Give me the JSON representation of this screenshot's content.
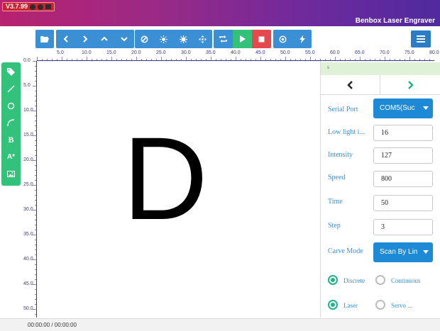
{
  "window": {
    "version": "V3.7.99",
    "title": "Benbox Laser Engraver"
  },
  "toolbar": {
    "groups": [
      [
        "open-folder"
      ],
      [
        "arrow-left",
        "arrow-right",
        "arrow-up",
        "arrow-down"
      ],
      [
        "circle-slash",
        "dot-small",
        "dot-large",
        "crosshair"
      ],
      [
        "repeat",
        "play",
        "stop"
      ],
      [
        "target",
        "bolt"
      ]
    ]
  },
  "rulers": {
    "top": [
      "5.0",
      "10.0",
      "15.0",
      "20.0",
      "25.0",
      "30.0",
      "35.0",
      "40.0",
      "45.0",
      "50.0",
      "55.0",
      "60.0",
      "65.0",
      "70.0",
      "75.0",
      "80.0"
    ],
    "left": [
      "0.0",
      "5.0",
      "10.0",
      "15.0",
      "20.0",
      "25.0",
      "30.0",
      "35.0",
      "40.0",
      "45.0",
      "50.0"
    ]
  },
  "tools": [
    "tag",
    "line",
    "circle",
    "arc",
    "B",
    "A*",
    "image"
  ],
  "canvas": {
    "text": "D"
  },
  "panel": {
    "header": "s",
    "properties": [
      {
        "label": "Serial Port",
        "type": "select",
        "value": "COM5(Suc"
      },
      {
        "label": "Low light i...",
        "type": "input",
        "value": "16"
      },
      {
        "label": "Intensity",
        "type": "input",
        "value": "127"
      },
      {
        "label": "Speed",
        "type": "input",
        "value": "800"
      },
      {
        "label": "Time",
        "type": "input",
        "value": "50"
      },
      {
        "label": "Step",
        "type": "input",
        "value": "3"
      },
      {
        "label": "Carve Mode",
        "type": "select",
        "value": "Scan By Lin"
      }
    ],
    "radios": [
      {
        "label": "Discrete",
        "checked": true
      },
      {
        "label": "Continuous",
        "checked": false
      },
      {
        "label": "Laser",
        "checked": true
      },
      {
        "label": "Servo ...",
        "checked": false
      }
    ]
  },
  "status": {
    "time": "00:00:00 / 00:00:00"
  },
  "colors": {
    "toolbar_blue": "#3a8fd5",
    "play_green": "#33c27a",
    "stop_red": "#e5484d",
    "tool_green": "#33c27a",
    "label_blue": "#3a8fd5",
    "radio_teal": "#1fb28c"
  }
}
